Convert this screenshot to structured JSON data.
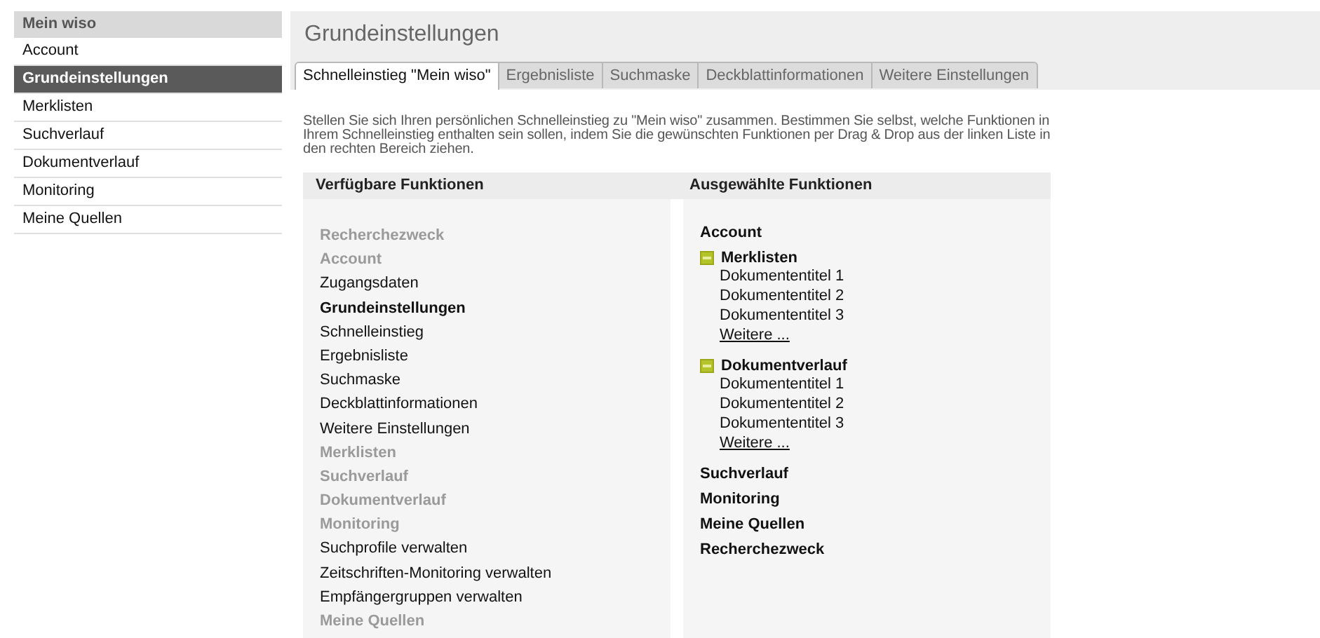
{
  "sidebar": {
    "title": "Mein wiso",
    "items": [
      {
        "label": "Account",
        "selected": false
      },
      {
        "label": "Grundeinstellungen",
        "selected": true
      },
      {
        "label": "Merklisten",
        "selected": false
      },
      {
        "label": "Suchverlauf",
        "selected": false
      },
      {
        "label": "Dokumentverlauf",
        "selected": false
      },
      {
        "label": "Monitoring",
        "selected": false
      },
      {
        "label": "Meine Quellen",
        "selected": false
      }
    ]
  },
  "page": {
    "title": "Grundeinstellungen",
    "tabs": [
      {
        "label": "Schnelleinstieg \"Mein wiso\"",
        "selected": true
      },
      {
        "label": "Ergebnisliste",
        "selected": false
      },
      {
        "label": "Suchmaske",
        "selected": false
      },
      {
        "label": "Deckblattinformationen",
        "selected": false
      },
      {
        "label": "Weitere Einstellungen",
        "selected": false
      }
    ],
    "description": "Stellen Sie sich Ihren persönlichen Schnelleinstieg zu \"Mein wiso\" zusammen. Bestimmen Sie selbst, welche Funktionen in Ihrem Schnelleinstieg enthalten sein sollen, indem Sie die gewünschten Funktionen per Drag & Drop aus der linken Liste in den rechten Bereich ziehen.",
    "available": {
      "title": "Verfügbare Funktionen",
      "items": [
        {
          "label": "Recherchezweck",
          "kind": "group",
          "disabled": true
        },
        {
          "label": "Account",
          "kind": "group",
          "disabled": true
        },
        {
          "label": "Zugangsdaten",
          "kind": "item",
          "disabled": false
        },
        {
          "label": "Grundeinstellungen",
          "kind": "group",
          "disabled": false
        },
        {
          "label": "Schnelleinstieg",
          "kind": "item",
          "disabled": false
        },
        {
          "label": "Ergebnisliste",
          "kind": "item",
          "disabled": false
        },
        {
          "label": "Suchmaske",
          "kind": "item",
          "disabled": false
        },
        {
          "label": "Deckblattinformationen",
          "kind": "item",
          "disabled": false
        },
        {
          "label": "Weitere Einstellungen",
          "kind": "item",
          "disabled": false
        },
        {
          "label": "Merklisten",
          "kind": "group",
          "disabled": true
        },
        {
          "label": "Suchverlauf",
          "kind": "group",
          "disabled": true
        },
        {
          "label": "Dokumentverlauf",
          "kind": "group",
          "disabled": true
        },
        {
          "label": "Monitoring",
          "kind": "group",
          "disabled": true
        },
        {
          "label": "Suchprofile verwalten",
          "kind": "item",
          "disabled": false
        },
        {
          "label": "Zeitschriften-Monitoring verwalten",
          "kind": "item",
          "disabled": false
        },
        {
          "label": "Empfängergruppen verwalten",
          "kind": "item",
          "disabled": false
        },
        {
          "label": "Meine Quellen",
          "kind": "group",
          "disabled": true
        }
      ]
    },
    "selected_functions": {
      "title": "Ausgewählte Funktionen",
      "items": [
        {
          "label": "Account"
        },
        {
          "label": "Merklisten",
          "expanded": true,
          "children": [
            {
              "label": "Dokumententitel 1"
            },
            {
              "label": "Dokumententitel 2"
            },
            {
              "label": "Dokumententitel 3"
            }
          ],
          "more": "Weitere ..."
        },
        {
          "label": "Dokumentverlauf",
          "expanded": true,
          "children": [
            {
              "label": "Dokumententitel 1"
            },
            {
              "label": "Dokumententitel 2"
            },
            {
              "label": "Dokumententitel 3"
            }
          ],
          "more": "Weitere ..."
        },
        {
          "label": "Suchverlauf"
        },
        {
          "label": "Monitoring"
        },
        {
          "label": "Meine Quellen"
        },
        {
          "label": "Recherchezweck"
        }
      ]
    }
  }
}
